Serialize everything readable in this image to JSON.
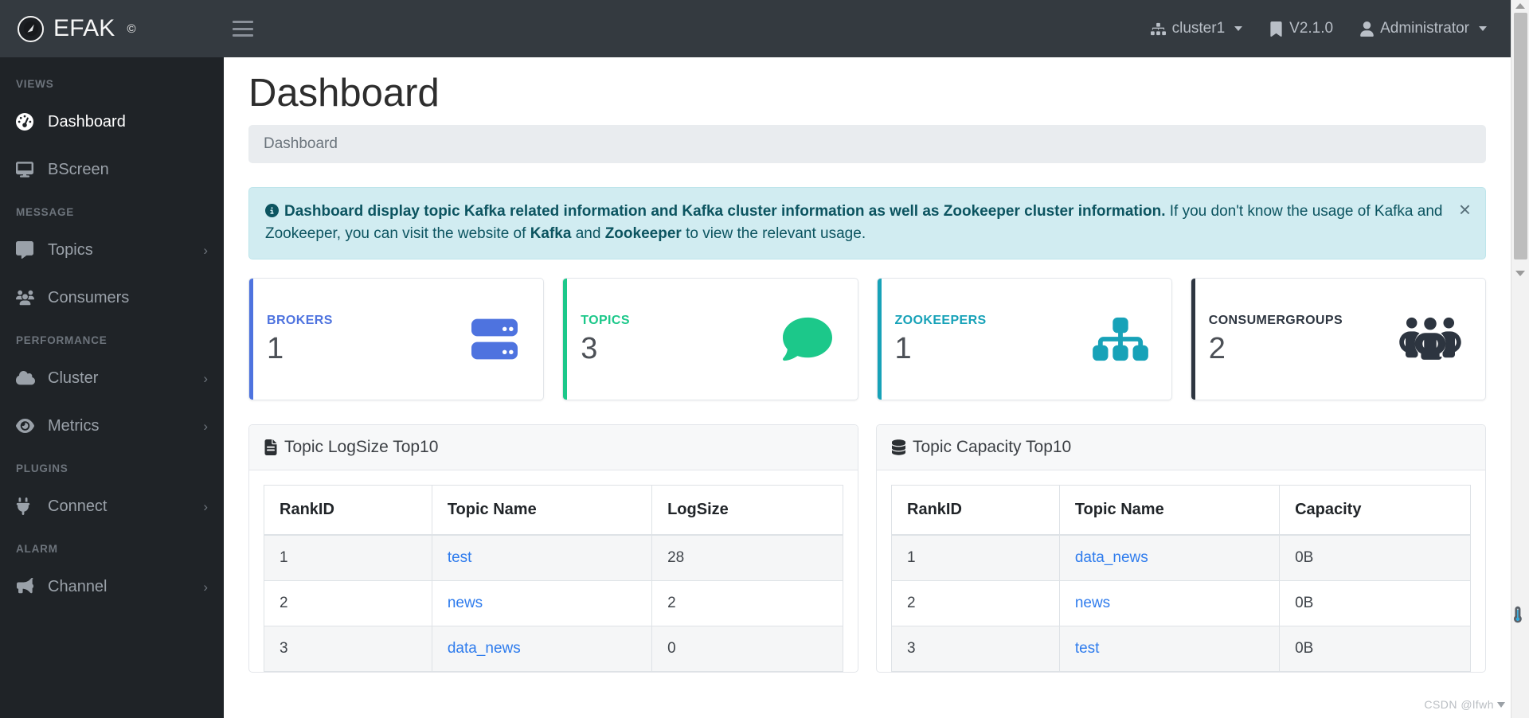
{
  "navbar": {
    "brand": "EFAK",
    "brand_sup": "©",
    "cluster": "cluster1",
    "version": "V2.1.0",
    "user": "Administrator"
  },
  "sidebar": {
    "groups": [
      {
        "title": "VIEWS",
        "items": [
          {
            "label": "Dashboard",
            "icon": "dashboard-icon",
            "active": true,
            "expandable": false
          },
          {
            "label": "BScreen",
            "icon": "monitor-icon",
            "active": false,
            "expandable": false
          }
        ]
      },
      {
        "title": "MESSAGE",
        "items": [
          {
            "label": "Topics",
            "icon": "comment-icon",
            "active": false,
            "expandable": true
          },
          {
            "label": "Consumers",
            "icon": "users-icon",
            "active": false,
            "expandable": false
          }
        ]
      },
      {
        "title": "PERFORMANCE",
        "items": [
          {
            "label": "Cluster",
            "icon": "cloud-icon",
            "active": false,
            "expandable": true
          },
          {
            "label": "Metrics",
            "icon": "eye-icon",
            "active": false,
            "expandable": true
          }
        ]
      },
      {
        "title": "PLUGINS",
        "items": [
          {
            "label": "Connect",
            "icon": "plug-icon",
            "active": false,
            "expandable": true
          }
        ]
      },
      {
        "title": "ALARM",
        "items": [
          {
            "label": "Channel",
            "icon": "bullhorn-icon",
            "active": false,
            "expandable": true
          }
        ]
      }
    ]
  },
  "page": {
    "title": "Dashboard",
    "breadcrumb": "Dashboard"
  },
  "alert": {
    "strong": "Dashboard display topic Kafka related information and Kafka cluster information as well as Zookeeper cluster information.",
    "rest_1": " If you don't know the usage of Kafka and Zookeeper, you can visit the website of ",
    "link_1": "Kafka",
    "mid": " and ",
    "link_2": "Zookeeper",
    "rest_2": " to view the relevant usage.",
    "close": "×"
  },
  "cards": [
    {
      "label": "BROKERS",
      "value": "1",
      "icon": "server-icon",
      "accent": "#4e73df"
    },
    {
      "label": "TOPICS",
      "value": "3",
      "icon": "comment-bubble-icon",
      "accent": "#1cc88a"
    },
    {
      "label": "ZOOKEEPERS",
      "value": "1",
      "icon": "sitemap-icon",
      "accent": "#17a2b8"
    },
    {
      "label": "CONSUMERGROUPS",
      "value": "2",
      "icon": "group-icon",
      "accent": "#2d3540"
    }
  ],
  "panels": [
    {
      "title": "Topic LogSize Top10",
      "icon": "file-alt-icon",
      "columns": [
        "RankID",
        "Topic Name",
        "LogSize"
      ],
      "rows": [
        [
          "1",
          "test",
          "28"
        ],
        [
          "2",
          "news",
          "2"
        ],
        [
          "3",
          "data_news",
          "0"
        ]
      ]
    },
    {
      "title": "Topic Capacity Top10",
      "icon": "database-icon",
      "columns": [
        "RankID",
        "Topic Name",
        "Capacity"
      ],
      "rows": [
        [
          "1",
          "data_news",
          "0B"
        ],
        [
          "2",
          "news",
          "0B"
        ],
        [
          "3",
          "test",
          "0B"
        ]
      ]
    }
  ],
  "watermark": "CSDN @lfwh"
}
